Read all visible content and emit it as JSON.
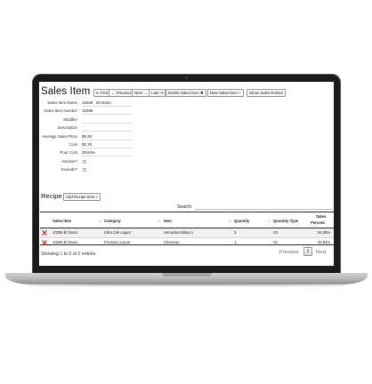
{
  "page": {
    "title": "Sales Item"
  },
  "toolbar": {
    "first": "⇤ First",
    "previous": "← Previous",
    "next": "Next →",
    "last": "Last ⇥",
    "delete": "Delete Sales Item ✖",
    "new": "New Sales Item +",
    "show": "Show Sales Entries"
  },
  "form": {
    "sales_item_name_label": "Sales Item Name",
    "sales_item_name_value_id": "10289",
    "sales_item_name_value_name": "El Novio",
    "sales_item_number_label": "Sales Item Number",
    "sales_item_number_value": "10289",
    "modifier_label": "Modifier",
    "modifier_value": "",
    "description_label": "Description",
    "description_value": "",
    "average_sales_price_label": "Average Sales Price",
    "average_sales_price_value": "$9.26",
    "cost_label": "Cost",
    "cost_value": "$2.76",
    "pour_cost_label": "Pour Cost",
    "pour_cost_value": "29.84%",
    "inactive_label": "Inactive?",
    "exclude_label": "Exclude?"
  },
  "recipe": {
    "title": "Recipe",
    "add_button": "Add Recipe Item +",
    "search_label": "Search:",
    "search_value": "",
    "columns": {
      "sales_item": "Sales Item",
      "category": "Category",
      "item": "Item",
      "quantity": "Quantity",
      "quantity_type": "Quantity Type",
      "sales_percent_line1": "Sales",
      "sales_percent_line2": "Percent"
    },
    "rows": [
      {
        "sales_item": "10289 El Novio",
        "category": "Ultra Cell Liquor",
        "item": "Herradura Blanco",
        "quantity": "3",
        "quantity_type": "Oz",
        "sales_percent": "54.06%"
      },
      {
        "sales_item": "10289 El Novio",
        "category": "Premium Liquor",
        "item": "Cherreau",
        "quantity": "1",
        "quantity_type": "Oz",
        "sales_percent": "45.94%"
      }
    ],
    "info": "Showing 1 to 2 of 2 entries",
    "pager": {
      "previous": "Previous",
      "current_page": "1",
      "next": "Next"
    }
  },
  "colors": {
    "bezel": "#1b1b1b",
    "remove_icon": "#d9352b",
    "row_alt": "#f2f2f2"
  },
  "icons": {
    "remove": "remove-x-icon",
    "sort": "sort-arrows-icon"
  }
}
